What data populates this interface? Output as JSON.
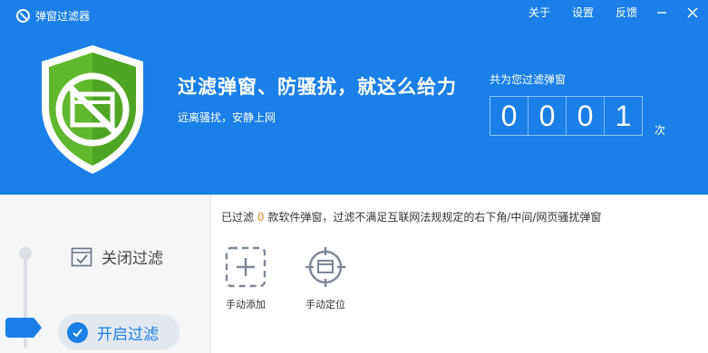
{
  "app": {
    "title": "弹窗过滤器"
  },
  "menu": {
    "about": "关于",
    "settings": "设置",
    "feedback": "反馈",
    "minimize_icon": "minimize-icon",
    "close_icon": "close-icon"
  },
  "hero": {
    "headline": "过滤弹窗、防骚扰，就这么给力",
    "subline": "远离骚扰，安静上网"
  },
  "counter": {
    "label": "共为您过滤弹窗",
    "digits": [
      "0",
      "0",
      "0",
      "1"
    ],
    "value": 1,
    "unit": "次"
  },
  "filter_options": {
    "close_label": "关闭过滤",
    "open_label": "开启过滤",
    "selected": "open"
  },
  "status": {
    "prefix": "已过滤",
    "count": "0",
    "suffix": "款软件弹窗，过滤不满足互联网法规规定的右下角/中间/网页骚扰弹窗"
  },
  "tools": {
    "add_label": "手动添加",
    "locate_label": "手动定位"
  },
  "colors": {
    "accent": "#1a7fe6",
    "shield_green": "#5fb82d",
    "count_highlight": "#f08a24"
  }
}
